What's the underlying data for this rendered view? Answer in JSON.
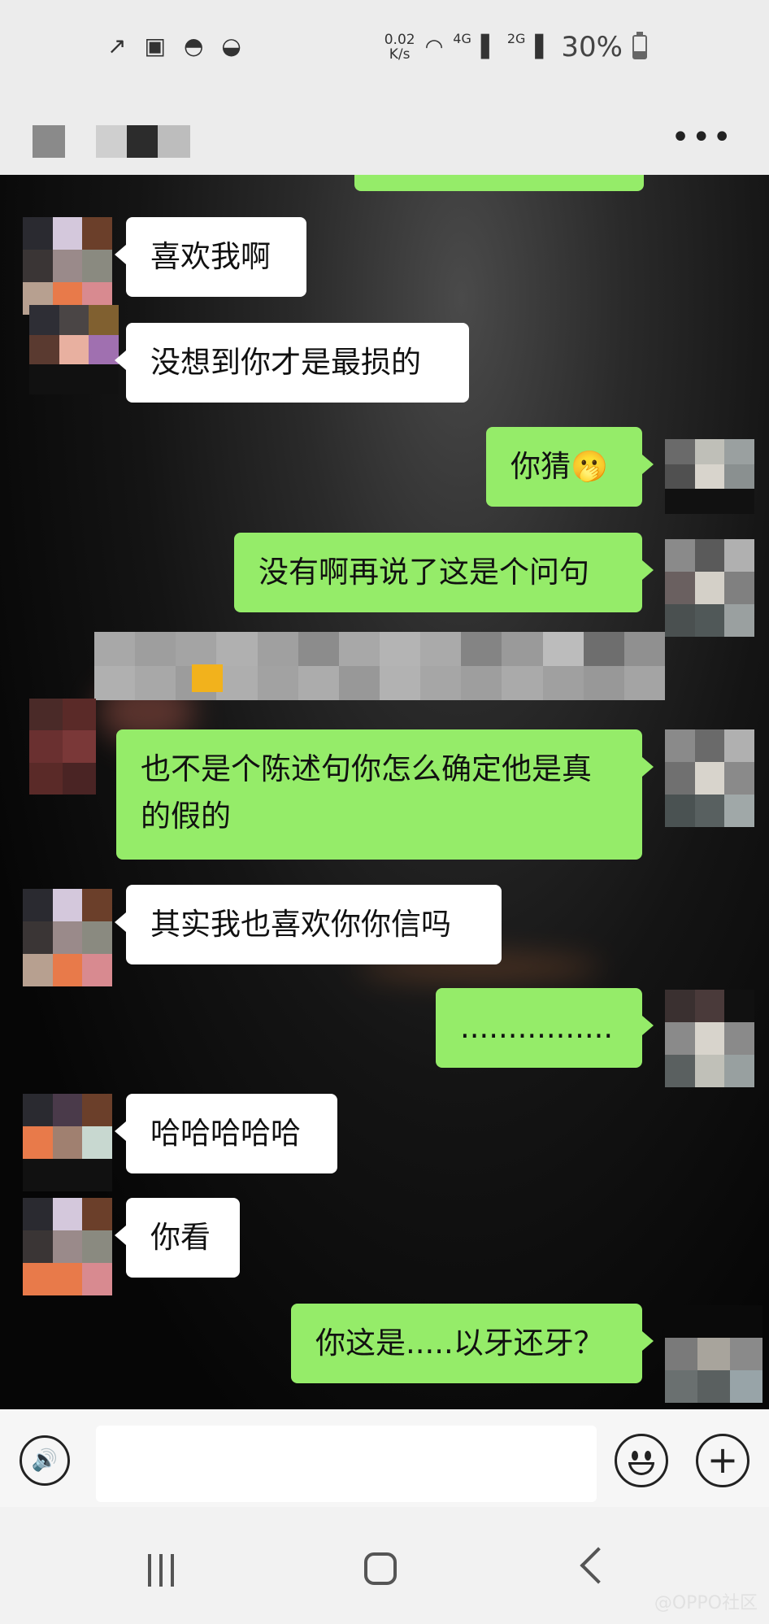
{
  "status_bar": {
    "net_speed_value": "0.02",
    "net_speed_unit": "K/s",
    "signal_1": "4G",
    "signal_2": "2G",
    "battery": "30%"
  },
  "header": {
    "more_label": "•••"
  },
  "messages": [
    {
      "side": "in",
      "text": "喜欢我啊"
    },
    {
      "side": "in",
      "text": "没想到你才是最损的"
    },
    {
      "side": "out",
      "text": "你猜🫢"
    },
    {
      "side": "out",
      "text": "没有啊再说了这是个问句"
    },
    {
      "side": "out",
      "text": "也不是个陈述句你怎么确定他是真的假的"
    },
    {
      "side": "in",
      "text": "其实我也喜欢你你信吗"
    },
    {
      "side": "out",
      "text": "................"
    },
    {
      "side": "in",
      "text": "哈哈哈哈哈"
    },
    {
      "side": "in",
      "text": "你看"
    },
    {
      "side": "out",
      "text": "你这是.....以牙还牙？"
    }
  ],
  "input_bar": {
    "voice_icon": "voice-icon",
    "emoji_icon": "emoji-icon",
    "plus_icon": "plus-icon",
    "plus_label": "+"
  },
  "nav": {
    "watermark": "@OPPO社区"
  }
}
